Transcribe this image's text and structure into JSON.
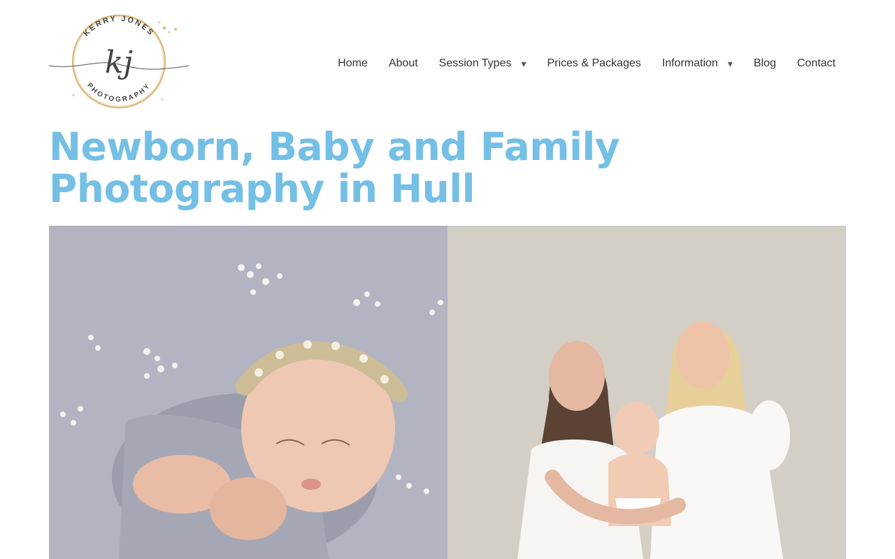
{
  "logo": {
    "top_text": "KERRY JONES",
    "monogram": "kj",
    "bottom_text": "PHOTOGRAPHY",
    "colors": {
      "ring": "#d9b97a",
      "ink": "#444444"
    }
  },
  "nav": {
    "items": [
      {
        "label": "Home",
        "has_dropdown": false
      },
      {
        "label": "About",
        "has_dropdown": false
      },
      {
        "label": "Session Types",
        "has_dropdown": true
      },
      {
        "label": "Prices & Packages",
        "has_dropdown": false
      },
      {
        "label": "Information",
        "has_dropdown": true
      },
      {
        "label": "Blog",
        "has_dropdown": false
      },
      {
        "label": "Contact",
        "has_dropdown": false
      }
    ],
    "dropdown_icon": "▾"
  },
  "hero": {
    "title": "Newborn, Baby and Family Photography in Hull",
    "title_color": "#74bfe5"
  },
  "gallery": {
    "images": [
      {
        "description_icon": "newborn-photo",
        "background": "#b3b4c2"
      },
      {
        "description_icon": "family-photo",
        "background": "#d3cec6"
      }
    ]
  }
}
